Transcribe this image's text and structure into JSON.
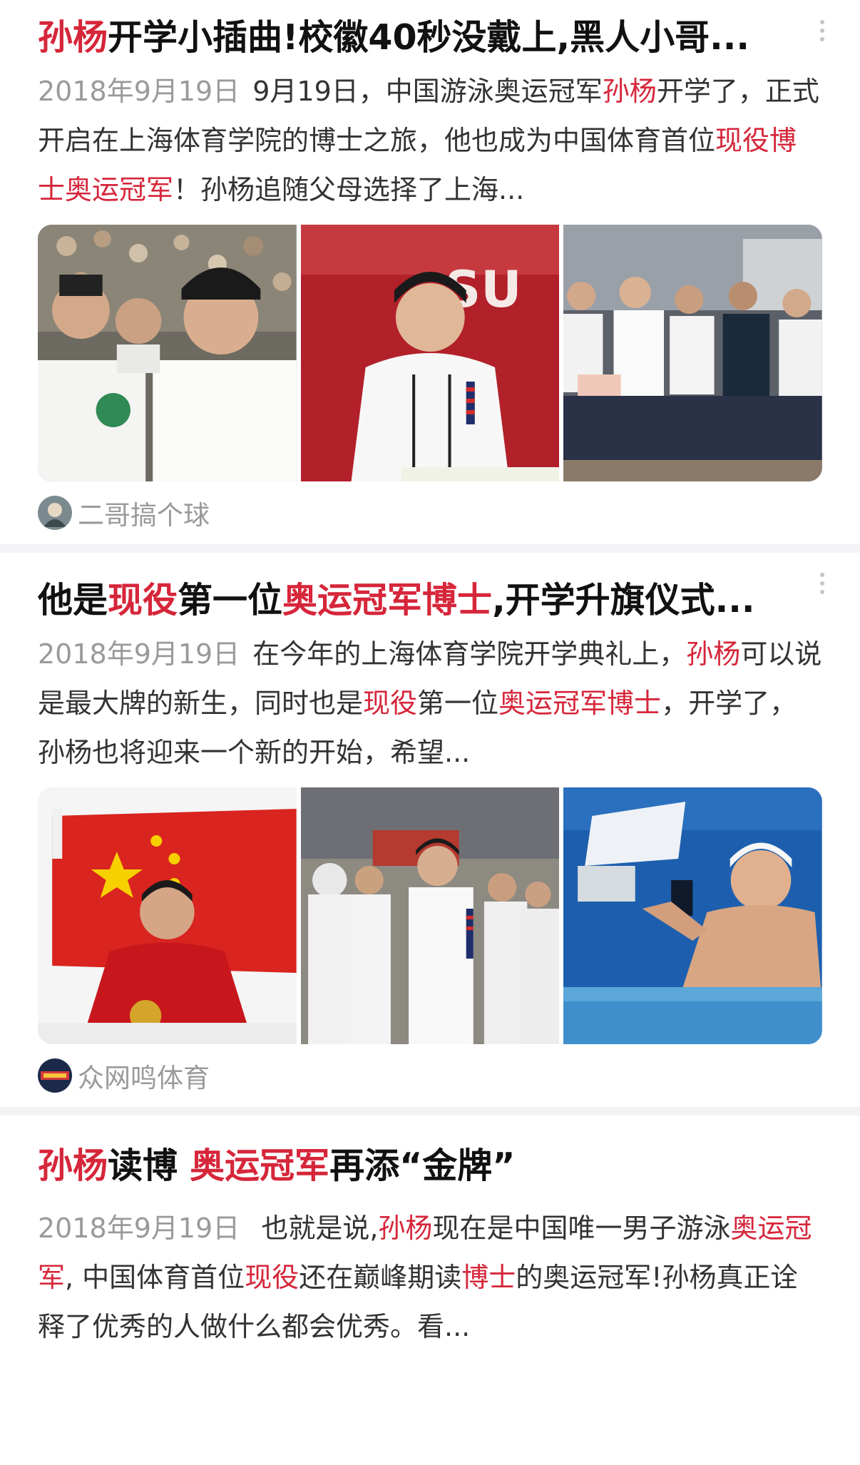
{
  "articles": [
    {
      "title_parts": [
        {
          "text": "孙杨",
          "hl": true
        },
        {
          "text": "开学小插曲!校徽40秒没戴上,黑人小哥...",
          "hl": false
        }
      ],
      "date": "2018年9月19日",
      "summary_parts": [
        {
          "text": "9月19日，中国游泳奥运冠军",
          "hl": false
        },
        {
          "text": "孙杨",
          "hl": true
        },
        {
          "text": "开学了，正式开启在上海体育学院的博士之旅，他也成为中国体育首位",
          "hl": false
        },
        {
          "text": "现役博士奥运冠军",
          "hl": true
        },
        {
          "text": "！孙杨追随父母选择了上海...",
          "hl": false
        }
      ],
      "images": [
        "athletes-in-white-shirts-stands-photo",
        "speech-at-podium-photo",
        "seated-audience-photo"
      ],
      "source": "二哥搞个球",
      "avatar": "source-avatar-icon"
    },
    {
      "title_parts": [
        {
          "text": "他是",
          "hl": false
        },
        {
          "text": "现役",
          "hl": true
        },
        {
          "text": "第一位",
          "hl": false
        },
        {
          "text": "奥运冠军博士",
          "hl": true
        },
        {
          "text": ",开学升旗仪式...",
          "hl": false
        }
      ],
      "date": "2018年9月19日",
      "summary_parts": [
        {
          "text": "在今年的上海体育学院开学典礼上，",
          "hl": false
        },
        {
          "text": "孙杨",
          "hl": true
        },
        {
          "text": "可以说是最大牌的新生，同时也是",
          "hl": false
        },
        {
          "text": "现役",
          "hl": true
        },
        {
          "text": "第一位",
          "hl": false
        },
        {
          "text": "奥运冠军博士",
          "hl": true
        },
        {
          "text": "，开学了，孙杨也将迎来一个新的开始，希望...",
          "hl": false
        }
      ],
      "images": [
        "flag-celebration-photo",
        "flag-ceremony-photo",
        "pool-celebration-photo"
      ],
      "source": "众网鸣体育",
      "avatar": "source-avatar-icon"
    },
    {
      "title_parts": [
        {
          "text": "孙杨",
          "hl": true
        },
        {
          "text": "读博 ",
          "hl": false
        },
        {
          "text": "奥运冠军",
          "hl": true
        },
        {
          "text": "再添“金牌”",
          "hl": false
        }
      ],
      "date": "2018年9月19日",
      "summary_parts": [
        {
          "text": " 也就是说,",
          "hl": false
        },
        {
          "text": "孙杨",
          "hl": true
        },
        {
          "text": "现在是中国唯一男子游泳",
          "hl": false
        },
        {
          "text": "奥运冠军",
          "hl": true
        },
        {
          "text": ", 中国体育首位",
          "hl": false
        },
        {
          "text": "现役",
          "hl": true
        },
        {
          "text": "还在巅峰期读",
          "hl": false
        },
        {
          "text": "博士",
          "hl": true
        },
        {
          "text": "的奥运冠军!孙杨真正诠释了优秀的人做什么都会优秀。看...",
          "hl": false
        }
      ]
    }
  ],
  "colors": {
    "highlight": "#d6263a",
    "meta": "#9a9a9a",
    "separator": "#f3f3f5"
  }
}
